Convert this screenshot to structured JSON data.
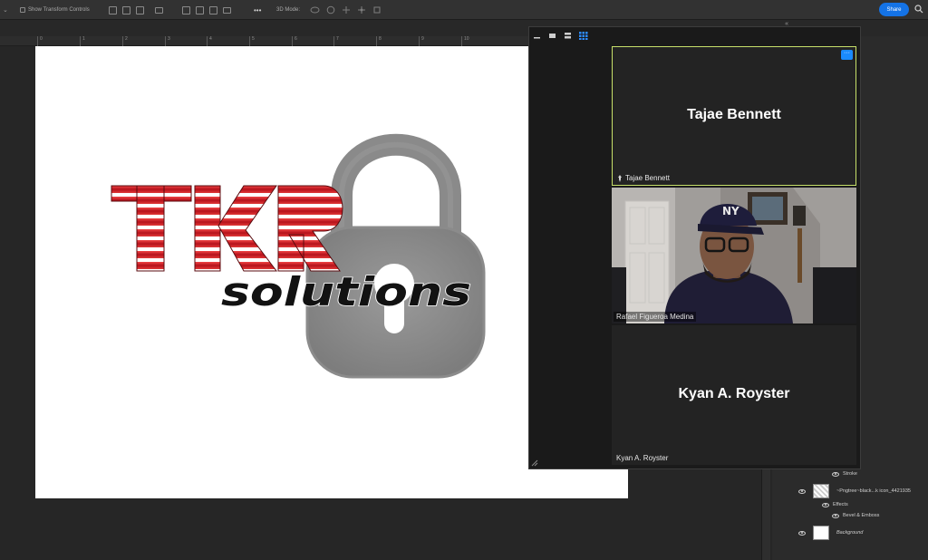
{
  "options_bar": {
    "checkbox_label": "Show Transform Controls",
    "mode_3d_label": "3D Mode:",
    "more_label": "•••",
    "share_label": "Share"
  },
  "ruler": {
    "ticks": [
      "0",
      "1",
      "2",
      "3",
      "4",
      "5",
      "6",
      "7",
      "8",
      "9",
      "10"
    ]
  },
  "canvas": {
    "logo_title": "TKR",
    "logo_subtitle": "solutions",
    "logo_colors": {
      "primary_red": "#d4202a",
      "dark": "#141414",
      "lock_gray": "#8f8f8f"
    }
  },
  "layers": {
    "stroke_label": "Stroke",
    "layer_name": "~Pngtree~black...k icon_4421935",
    "effects_label": "Effects",
    "bevel_label": "Bevel & Emboss",
    "background_label": "Background"
  },
  "zoom": {
    "participants": [
      {
        "display_name": "Tajae Bennett",
        "label": "Tajae Bennett",
        "active_speaker": true,
        "video_on": false
      },
      {
        "display_name": "",
        "label": "Rafael Figueroa Medina",
        "active_speaker": false,
        "video_on": true
      },
      {
        "display_name": "Kyan A. Royster",
        "label": "Kyan A. Royster",
        "active_speaker": false,
        "video_on": false
      }
    ],
    "more_button_label": "···",
    "accent_active_border": "#c7e06a",
    "accent_button": "#1a8bff"
  }
}
